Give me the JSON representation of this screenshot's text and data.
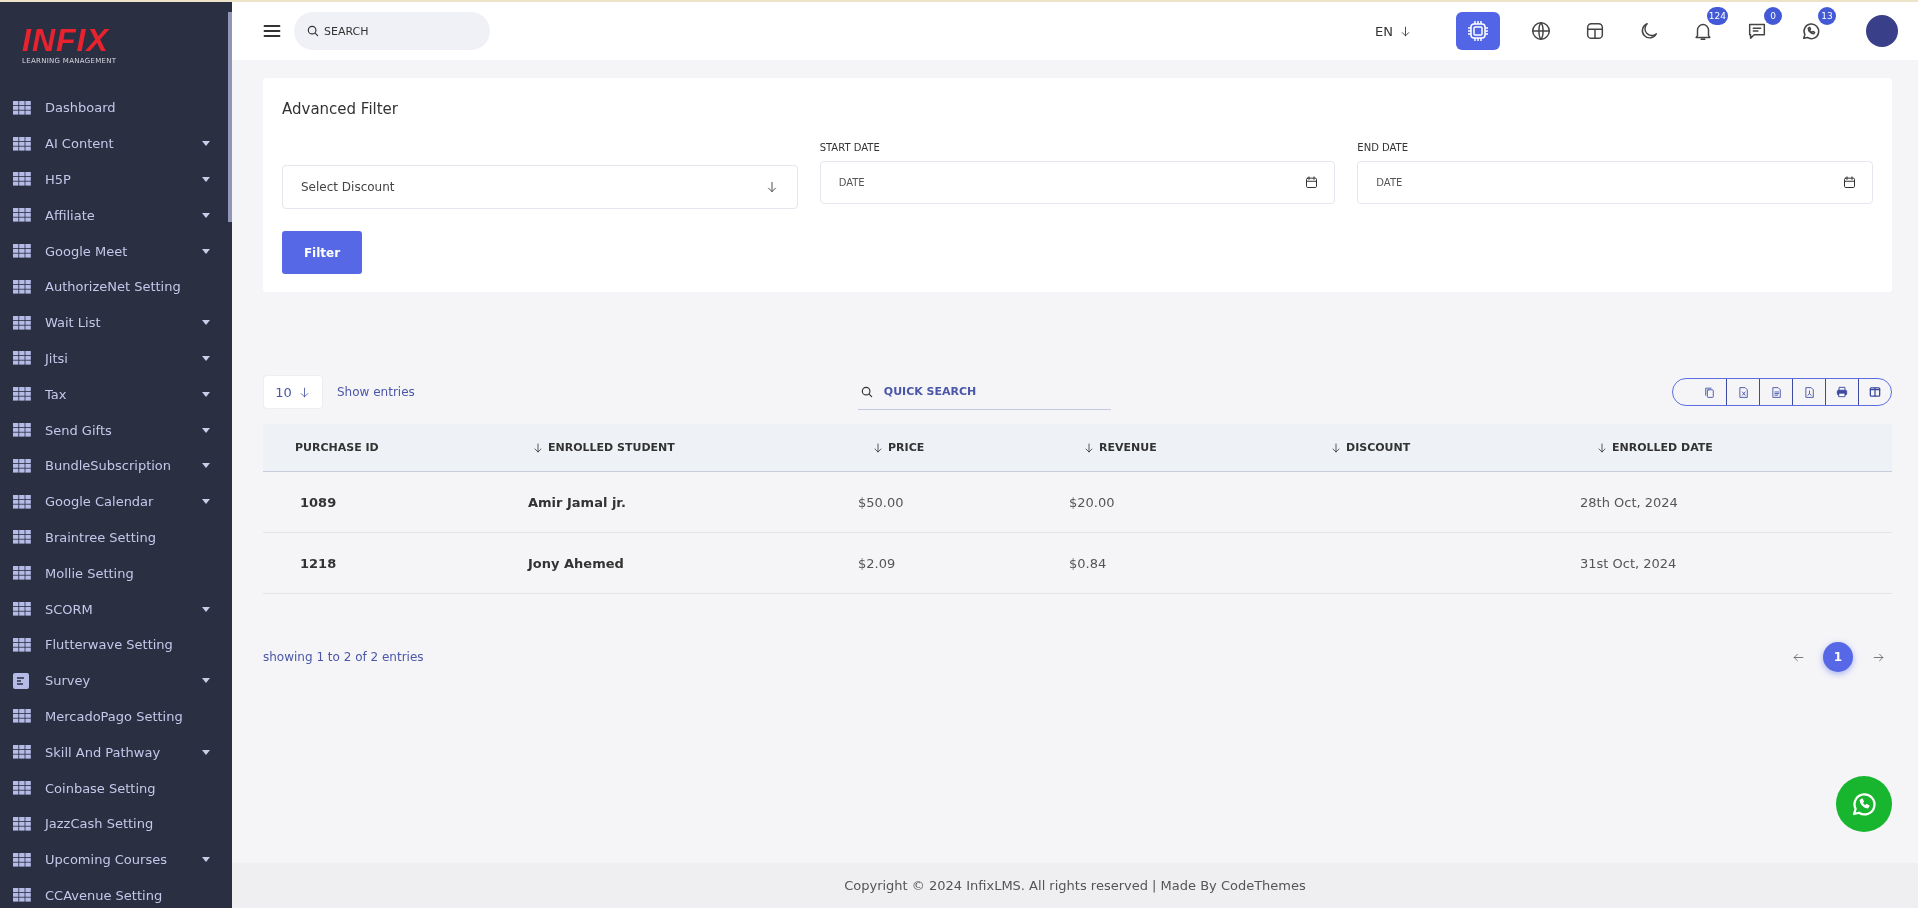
{
  "logo": {
    "title": "INFIX",
    "subtitle": "LEARNING MANAGEMENT"
  },
  "sidebar": {
    "items": [
      {
        "label": "Dashboard",
        "kind": "grid",
        "has_submenu": false
      },
      {
        "label": "AI Content",
        "kind": "grid",
        "has_submenu": true
      },
      {
        "label": "H5P",
        "kind": "grid",
        "has_submenu": true
      },
      {
        "label": "Affiliate",
        "kind": "grid",
        "has_submenu": true
      },
      {
        "label": "Google Meet",
        "kind": "grid",
        "has_submenu": true
      },
      {
        "label": "AuthorizeNet Setting",
        "kind": "grid",
        "has_submenu": false
      },
      {
        "label": "Wait List",
        "kind": "grid",
        "has_submenu": true
      },
      {
        "label": "Jitsi",
        "kind": "grid",
        "has_submenu": true
      },
      {
        "label": "Tax",
        "kind": "grid",
        "has_submenu": true
      },
      {
        "label": "Send Gifts",
        "kind": "grid",
        "has_submenu": true
      },
      {
        "label": "BundleSubscription",
        "kind": "grid",
        "has_submenu": true
      },
      {
        "label": "Google Calendar",
        "kind": "grid",
        "has_submenu": true
      },
      {
        "label": "Braintree Setting",
        "kind": "grid",
        "has_submenu": false
      },
      {
        "label": "Mollie Setting",
        "kind": "grid",
        "has_submenu": false
      },
      {
        "label": "SCORM",
        "kind": "grid",
        "has_submenu": true
      },
      {
        "label": "Flutterwave Setting",
        "kind": "grid",
        "has_submenu": false
      },
      {
        "label": "Survey",
        "kind": "form",
        "has_submenu": true
      },
      {
        "label": "MercadoPago Setting",
        "kind": "grid",
        "has_submenu": false
      },
      {
        "label": "Skill And Pathway",
        "kind": "grid",
        "has_submenu": true
      },
      {
        "label": "Coinbase Setting",
        "kind": "grid",
        "has_submenu": false
      },
      {
        "label": "JazzCash Setting",
        "kind": "grid",
        "has_submenu": false
      },
      {
        "label": "Upcoming Courses",
        "kind": "grid",
        "has_submenu": true
      },
      {
        "label": "CCAvenue Setting",
        "kind": "grid",
        "has_submenu": false
      }
    ]
  },
  "header": {
    "search": {
      "placeholder": "SEARCH"
    },
    "language": "EN",
    "badges": {
      "notifications": "124",
      "messages": "0",
      "whatsapp": "13"
    }
  },
  "filter": {
    "title": "Advanced Filter",
    "discount_select": "Select Discount",
    "start_date": {
      "label": "START DATE",
      "placeholder": "DATE"
    },
    "end_date": {
      "label": "END DATE",
      "placeholder": "DATE"
    },
    "button": "Filter"
  },
  "table_controls": {
    "page_size": "10",
    "show_entries": "Show entries",
    "search_placeholder": "QUICK SEARCH"
  },
  "table": {
    "columns": [
      {
        "label": "PURCHASE ID",
        "sortable": false
      },
      {
        "label": "ENROLLED STUDENT",
        "sortable": true
      },
      {
        "label": "PRICE",
        "sortable": true
      },
      {
        "label": "REVENUE",
        "sortable": true
      },
      {
        "label": "DISCOUNT",
        "sortable": true
      },
      {
        "label": "ENROLLED DATE",
        "sortable": true
      }
    ],
    "rows": [
      {
        "cells": [
          "1089",
          "Amir Jamal jr.",
          "$50.00",
          "$20.00",
          null,
          "28th Oct, 2024"
        ]
      },
      {
        "cells": [
          "1218",
          "Jony Ahemed",
          "$2.09",
          "$0.84",
          null,
          "31st Oct, 2024"
        ]
      }
    ]
  },
  "pagination": {
    "summary": "showing 1 to 2 of 2 entries",
    "pages": [
      {
        "label": "1",
        "selected": true
      }
    ]
  },
  "footer": "Copyright © 2024 InfixLMS. All rights reserved | Made By CodeThemes"
}
